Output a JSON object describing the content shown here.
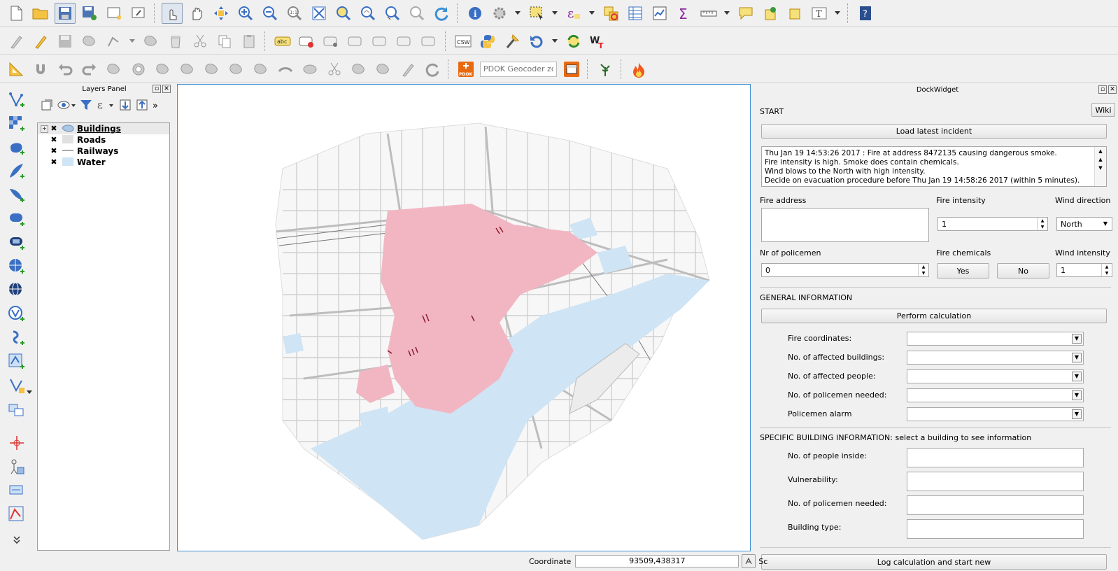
{
  "toolbar": {
    "pdok_label": "PDOK",
    "pdok_placeholder": "PDOK Geocoder zoek",
    "csw_label": "CSW",
    "wkt_label": "WKT",
    "abc_label": "abc"
  },
  "layers_panel": {
    "title": "Layers Panel",
    "layers": [
      {
        "name": "Buildings",
        "checked": true,
        "swatch": "#a9c6e2"
      },
      {
        "name": "Roads",
        "checked": true,
        "swatch": "#e0e0e0"
      },
      {
        "name": "Railways",
        "checked": true,
        "swatch": "line"
      },
      {
        "name": "Water",
        "checked": true,
        "swatch": "#cfe4f4"
      }
    ]
  },
  "dock": {
    "title": "DockWidget",
    "start_label": "START",
    "wiki_button": "Wiki",
    "load_button": "Load latest incident",
    "incident_lines": [
      "Thu Jan 19 14:53:26 2017 : Fire at address 8472135 causing dangerous smoke.",
      "Fire intensity is high. Smoke does contain chemicals.",
      "Wind blows to the North with high intensity.",
      "Decide on evacuation procedure before Thu Jan 19 14:58:26 2017 (within 5 minutes)."
    ],
    "fire_address_label": "Fire address",
    "fire_intensity_label": "Fire intensity",
    "fire_intensity_value": "1",
    "wind_direction_label": "Wind direction",
    "wind_direction_value": "North",
    "nr_policemen_label": "Nr of policemen",
    "nr_policemen_value": "0",
    "fire_chemicals_label": "Fire chemicals",
    "yes_button": "Yes",
    "no_button": "No",
    "wind_intensity_label": "Wind intensity",
    "wind_intensity_value": "1",
    "general_info_label": "GENERAL INFORMATION",
    "perform_button": "Perform calculation",
    "general_fields": [
      "Fire coordinates:",
      "No. of affected buildings:",
      "No. of affected people:",
      "No. of policemen needed:",
      "Policemen alarm"
    ],
    "specific_label": "SPECIFIC BUILDING INFORMATION: select a building to see information",
    "specific_fields": [
      "No. of people inside:",
      "Vulnerability:",
      "No. of policemen needed:",
      "Building type:"
    ],
    "log_button": "Log calculation and start new"
  },
  "status": {
    "coordinate_label": "Coordinate",
    "coordinate_value": "93509,438317",
    "scale_label_partial": "Sc"
  },
  "colors": {
    "accent": "#3c8fd6",
    "buildings": "#f2b6c3",
    "water": "#cfe4f4",
    "fire": "#f05a1e"
  }
}
